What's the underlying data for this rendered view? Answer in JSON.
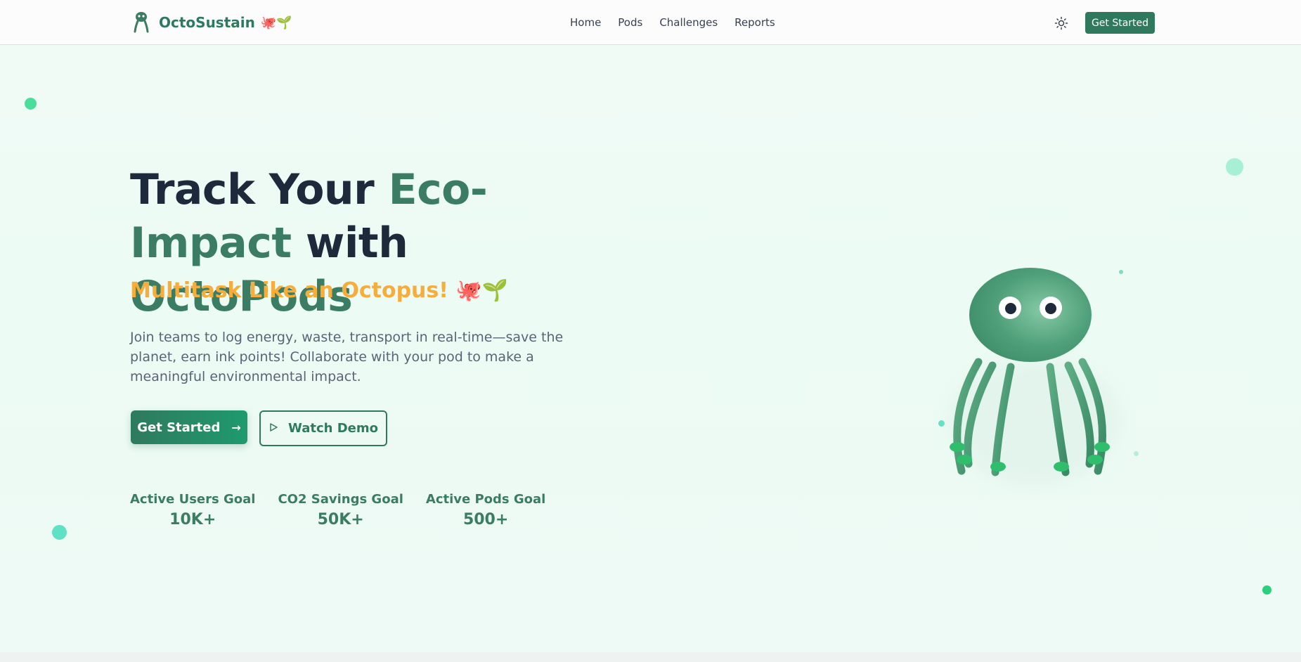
{
  "header": {
    "brand_name": "OctoSustain",
    "brand_emoji": "🐙🌱",
    "nav": [
      {
        "label": "Home"
      },
      {
        "label": "Pods"
      },
      {
        "label": "Challenges"
      },
      {
        "label": "Reports"
      }
    ],
    "theme_icon": "sun-icon",
    "cta_label": "Get Started"
  },
  "hero": {
    "title_part1": "Track Your ",
    "title_accent1": "Eco-",
    "title_accent2": "Impact",
    "title_part2": " with ",
    "title_accent3": "OctoPods",
    "tagline": "Multitask Like an Octopus! 🐙🌱",
    "description": "Join teams to log energy, waste, transport in real-time—save the planet, earn ink points! Collaborate with your pod to make a meaningful environmental impact.",
    "primary_button": "Get Started",
    "primary_icon": "arrow-right-icon",
    "secondary_button": "Watch Demo",
    "secondary_icon": "play-icon"
  },
  "stats": [
    {
      "label": "Active Users Goal",
      "value": "10K+"
    },
    {
      "label": "CO2 Savings Goal",
      "value": "50K+"
    },
    {
      "label": "Active Pods Goal",
      "value": "500+"
    }
  ],
  "colors": {
    "brand": "#2f7a5f",
    "accent": "#f6ad3c",
    "heading": "#1e293b"
  }
}
